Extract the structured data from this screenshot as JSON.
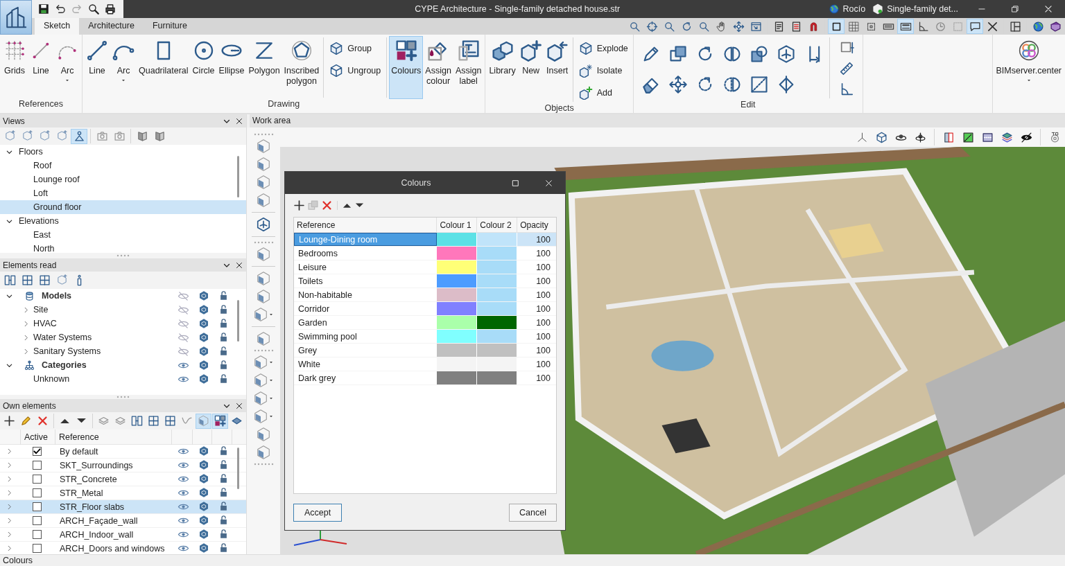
{
  "titlebar": {
    "title": "CYPE Architecture - Single-family detached house.str",
    "user": "Rocío",
    "project": "Single-family det..."
  },
  "tabs": [
    {
      "label": "Sketch",
      "selected": true
    },
    {
      "label": "Architecture",
      "selected": false
    },
    {
      "label": "Furniture",
      "selected": false
    }
  ],
  "view_tools": [
    {
      "pressed": false
    },
    {
      "pressed": false
    },
    {
      "pressed": false
    },
    {
      "pressed": false
    },
    {
      "pressed": false
    },
    {
      "pressed": false
    },
    {
      "pressed": false
    },
    {
      "pressed": false
    },
    {
      "pressed": false
    },
    {
      "pressed": false
    },
    {
      "pressed": false
    },
    {
      "pressed": true
    },
    {
      "pressed": false
    },
    {
      "pressed": false
    },
    {
      "pressed": false
    },
    {
      "pressed": true
    },
    {
      "pressed": false
    },
    {
      "pressed": false
    },
    {
      "pressed": false
    },
    {
      "pressed": true
    },
    {
      "pressed": false
    },
    {
      "pressed": false
    },
    {
      "pressed": false
    },
    {
      "pressed": false
    }
  ],
  "ribbon": {
    "groups": [
      {
        "label": "References",
        "kind": "buttons",
        "items": [
          {
            "kind": "large",
            "label": "Grids",
            "selected": false
          },
          {
            "kind": "large",
            "label": "Line",
            "selected": false
          },
          {
            "kind": "large",
            "label": "Arc",
            "selected": false,
            "dropdown": true
          }
        ]
      },
      {
        "label": "Drawing",
        "kind": "buttons",
        "items": [
          {
            "kind": "large",
            "label": "Line",
            "selected": false
          },
          {
            "kind": "large",
            "label": "Arc",
            "selected": false,
            "dropdown": true
          },
          {
            "kind": "large",
            "label": "Quadrilateral",
            "selected": false
          },
          {
            "kind": "large",
            "label": "Circle",
            "selected": false
          },
          {
            "kind": "large",
            "label": "Ellipse",
            "selected": false
          },
          {
            "kind": "large",
            "label": "Polygon",
            "selected": false
          },
          {
            "kind": "large",
            "label": "Inscribed polygon",
            "selected": false
          },
          {
            "kind": "small",
            "label": "Group",
            "selected": false
          },
          {
            "kind": "small",
            "label": "Ungroup",
            "selected": false
          },
          {
            "kind": "large",
            "label": "Colours",
            "selected": true
          },
          {
            "kind": "large",
            "label": "Assign colour",
            "selected": false
          },
          {
            "kind": "large",
            "label": "Assign label",
            "selected": false
          }
        ]
      },
      {
        "label": "Objects",
        "kind": "buttons",
        "items": [
          {
            "kind": "large",
            "label": "Library",
            "selected": false
          },
          {
            "kind": "large",
            "label": "New",
            "selected": false
          },
          {
            "kind": "large",
            "label": "Insert",
            "selected": false
          },
          {
            "kind": "small",
            "label": "Explode",
            "selected": false
          },
          {
            "kind": "small",
            "label": "Isolate",
            "selected": false
          },
          {
            "kind": "small",
            "label": "Add",
            "selected": false
          }
        ]
      },
      {
        "label": "Edit",
        "kind": "tools"
      },
      {
        "kind": "buttons",
        "items": [
          {
            "kind": "large",
            "label": "BIMserver.center",
            "selected": false,
            "dropdown": true
          }
        ]
      }
    ]
  },
  "views": {
    "title": "Views",
    "tools": [
      {
        "pressed": false
      },
      {
        "pressed": false
      },
      {
        "pressed": false
      },
      {
        "pressed": false
      },
      {
        "pressed": true
      },
      {
        "pressed": false
      },
      {
        "pressed": false
      },
      {
        "pressed": false
      },
      {
        "pressed": false
      }
    ],
    "tree": [
      {
        "label": "Floors",
        "expanded": true,
        "selected": false,
        "children": [
          {
            "label": "Roof",
            "selected": false
          },
          {
            "label": "Lounge roof",
            "selected": false
          },
          {
            "label": "Loft",
            "selected": false
          },
          {
            "label": "Ground floor",
            "selected": true
          }
        ]
      },
      {
        "label": "Elevations",
        "expanded": true,
        "selected": false,
        "children": [
          {
            "label": "East",
            "selected": false
          },
          {
            "label": "North",
            "selected": false
          }
        ]
      }
    ]
  },
  "elements_read": {
    "title": "Elements read",
    "tree": [
      {
        "label": "Models",
        "expanded": true,
        "visible": false,
        "selected": false,
        "children": [
          {
            "label": "Site",
            "expanded": false,
            "visible": false,
            "selected": false
          },
          {
            "label": "HVAC",
            "expanded": false,
            "visible": false,
            "selected": false
          },
          {
            "label": "Water Systems",
            "expanded": false,
            "visible": false,
            "selected": false
          },
          {
            "label": "Sanitary Systems",
            "expanded": false,
            "visible": false,
            "selected": false
          }
        ]
      },
      {
        "label": "Categories",
        "expanded": true,
        "visible": true,
        "selected": false,
        "children": [
          {
            "label": "Unknown",
            "visible": true,
            "selected": false
          }
        ]
      }
    ]
  },
  "own_elements": {
    "title": "Own elements",
    "tools": [
      {
        "pressed": false
      },
      {
        "pressed": false
      },
      {
        "pressed": false
      },
      {
        "pressed": false
      },
      {
        "pressed": false
      },
      {
        "pressed": false
      },
      {
        "pressed": false
      },
      {
        "pressed": false
      },
      {
        "pressed": false
      },
      {
        "pressed": false
      },
      {
        "pressed": false
      },
      {
        "pressed": true
      },
      {
        "pressed": true
      },
      {
        "pressed": false
      }
    ],
    "columns": [
      "Active",
      "Reference"
    ],
    "rows": [
      {
        "label": "By default",
        "active": true,
        "selected": false
      },
      {
        "label": "SKT_Surroundings",
        "active": false,
        "selected": false
      },
      {
        "label": "STR_Concrete",
        "active": false,
        "selected": false
      },
      {
        "label": "STR_Metal",
        "active": false,
        "selected": false
      },
      {
        "label": "STR_Floor slabs",
        "active": false,
        "selected": true
      },
      {
        "label": "ARCH_Façade_wall",
        "active": false,
        "selected": false
      },
      {
        "label": "ARCH_Indoor_wall",
        "active": false,
        "selected": false
      },
      {
        "label": "ARCH_Doors and windows",
        "active": false,
        "selected": false
      }
    ]
  },
  "work_area": {
    "title": "Work area"
  },
  "colours_dialog": {
    "title": "Colours",
    "columns": [
      "Reference",
      "Colour 1",
      "Colour 2",
      "Opacity"
    ],
    "rows": [
      {
        "label": "Lounge-Dining room",
        "swatches": [
          {
            "color": "#5ce1e6"
          },
          {
            "color": "#c0e4fa"
          }
        ],
        "opacity": "100",
        "selected": true
      },
      {
        "label": "Bedrooms",
        "swatches": [
          {
            "color": "#ff77bb"
          },
          {
            "color": "#a8dcf8"
          }
        ],
        "opacity": "100",
        "selected": false
      },
      {
        "label": "Leisure",
        "swatches": [
          {
            "color": "#ffff77"
          },
          {
            "color": "#a8dcf8"
          }
        ],
        "opacity": "100",
        "selected": false
      },
      {
        "label": "Toilets",
        "swatches": [
          {
            "color": "#4d9cff"
          },
          {
            "color": "#a8dcf8"
          }
        ],
        "opacity": "100",
        "selected": false
      },
      {
        "label": "Non-habitable",
        "swatches": [
          {
            "color": "#dcbcc8"
          },
          {
            "color": "#a8dcf8"
          }
        ],
        "opacity": "100",
        "selected": false
      },
      {
        "label": "Corridor",
        "swatches": [
          {
            "color": "#8080ff"
          },
          {
            "color": "#a8dcf8"
          }
        ],
        "opacity": "100",
        "selected": false
      },
      {
        "label": "Garden",
        "swatches": [
          {
            "color": "#aaffaa"
          },
          {
            "color": "#006600"
          }
        ],
        "opacity": "100",
        "selected": false
      },
      {
        "label": "Swimming pool",
        "swatches": [
          {
            "color": "#80ffff"
          },
          {
            "color": "#a8dcf8"
          }
        ],
        "opacity": "100",
        "selected": false
      },
      {
        "label": "Grey",
        "swatches": [
          {
            "color": "#c0c0c0"
          },
          {
            "color": "#c0c0c0"
          }
        ],
        "opacity": "100",
        "selected": false
      },
      {
        "label": "White",
        "swatches": [
          {
            "color": "#f4f4f4"
          },
          {
            "color": "#f4f4f4"
          }
        ],
        "opacity": "100",
        "selected": false
      },
      {
        "label": "Dark grey",
        "swatches": [
          {
            "color": "#808080"
          },
          {
            "color": "#808080"
          }
        ],
        "opacity": "100",
        "selected": false
      }
    ],
    "buttons": [
      "Accept",
      "Cancel"
    ]
  },
  "status_bar": "Colours"
}
